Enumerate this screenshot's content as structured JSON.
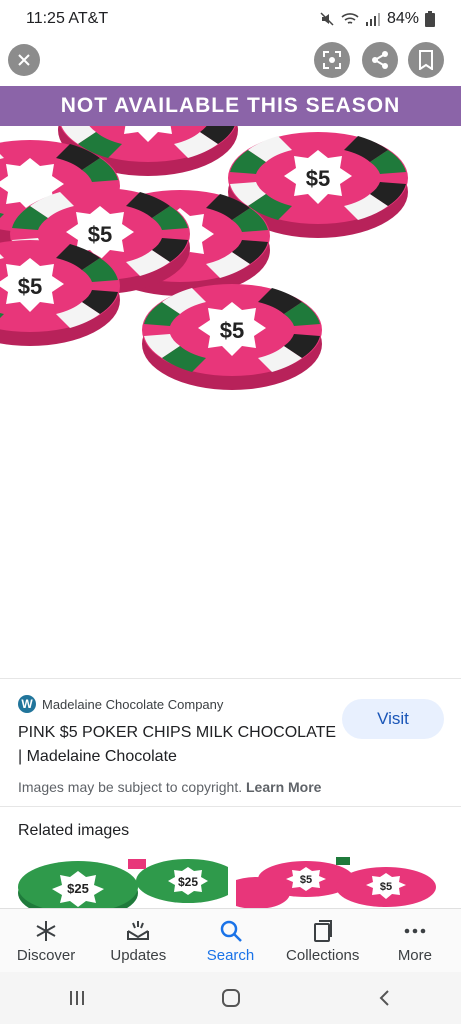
{
  "status": {
    "time": "11:25 AT&T",
    "battery": "84%"
  },
  "banner": {
    "text": "NOT AVAILABLE THIS SEASON"
  },
  "chips": {
    "label": "$5"
  },
  "result": {
    "source": "Madelaine Chocolate Company",
    "title": "PINK $5 POKER CHIPS MILK CHOCOLATE | Madelaine Chocolate",
    "visit_label": "Visit",
    "copyright_text": "Images may be subject to copyright.",
    "learn_more": "Learn More"
  },
  "related": {
    "title": "Related images",
    "thumb_labels": [
      "$25",
      "$5"
    ]
  },
  "nav": {
    "items": [
      {
        "label": "Discover",
        "icon": "asterisk-icon"
      },
      {
        "label": "Updates",
        "icon": "updates-icon"
      },
      {
        "label": "Search",
        "icon": "search-icon"
      },
      {
        "label": "Collections",
        "icon": "collections-icon"
      },
      {
        "label": "More",
        "icon": "more-icon"
      }
    ]
  },
  "colors": {
    "banner": "#8b64a8",
    "chip_pink": "#e8367a",
    "visit_bg": "#e8f0fe",
    "active_nav": "#1a73e8"
  }
}
